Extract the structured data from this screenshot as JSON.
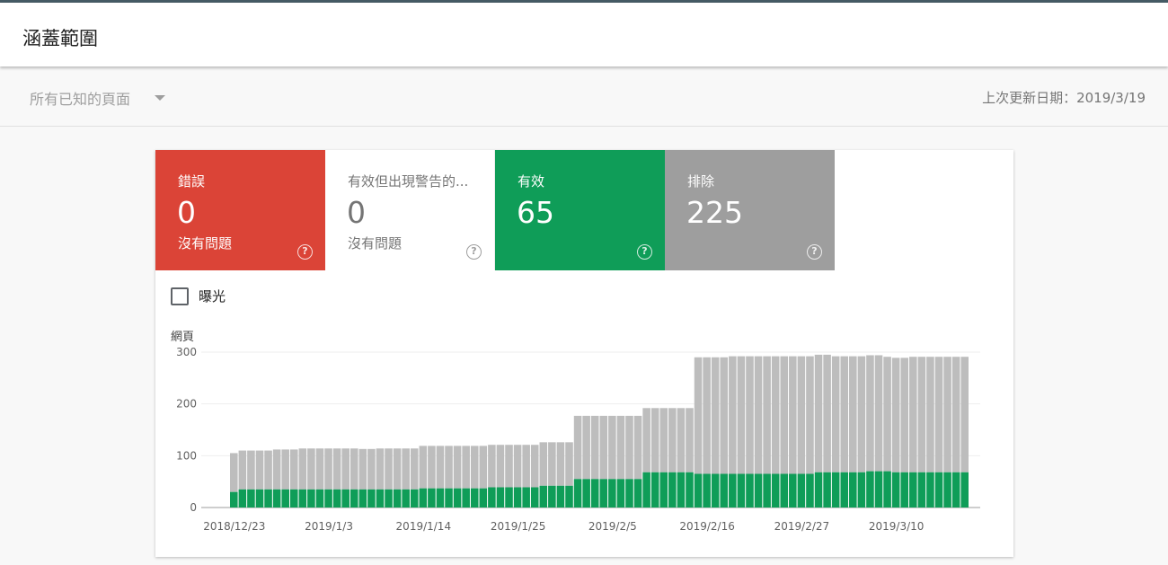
{
  "header": {
    "title": "涵蓋範圍"
  },
  "filter": {
    "selected": "所有已知的頁面",
    "last_updated": "上次更新日期：2019/3/19"
  },
  "tiles": [
    {
      "label": "錯誤",
      "count": "0",
      "sub": "沒有問題",
      "help": "?"
    },
    {
      "label": "有效但出現警告的...",
      "count": "0",
      "sub": "沒有問題",
      "help": "?"
    },
    {
      "label": "有效",
      "count": "65",
      "sub": "",
      "help": "?"
    },
    {
      "label": "排除",
      "count": "225",
      "sub": "",
      "help": "?"
    }
  ],
  "impressions": {
    "label": "曝光",
    "checked": false
  },
  "colors": {
    "valid": "#0f9d58",
    "excluded": "#bdbdbd",
    "error": "#db4437",
    "excluded_tile": "#9e9e9e"
  },
  "chart_data": {
    "type": "bar",
    "ylabel": "網頁",
    "ylim": [
      0,
      300
    ],
    "yticks": [
      0,
      100,
      200,
      300
    ],
    "xtick_labels": [
      "2018/12/23",
      "2019/1/3",
      "2019/1/14",
      "2019/1/25",
      "2019/2/5",
      "2019/2/16",
      "2019/2/27",
      "2019/3/10"
    ],
    "x_start": "2018/12/23",
    "series": [
      {
        "name": "有效",
        "values": [
          30,
          35,
          35,
          35,
          35,
          35,
          35,
          35,
          35,
          35,
          35,
          35,
          35,
          35,
          35,
          35,
          35,
          35,
          35,
          35,
          35,
          35,
          37,
          37,
          37,
          37,
          37,
          37,
          37,
          37,
          39,
          39,
          39,
          39,
          39,
          39,
          42,
          42,
          42,
          42,
          55,
          55,
          55,
          55,
          55,
          55,
          55,
          55,
          68,
          68,
          68,
          68,
          68,
          68,
          65,
          65,
          65,
          65,
          65,
          65,
          65,
          65,
          65,
          65,
          65,
          65,
          65,
          65,
          68,
          68,
          68,
          68,
          68,
          68,
          70,
          70,
          70,
          68,
          68,
          68,
          68,
          68,
          68,
          68,
          68,
          68
        ]
      },
      {
        "name": "排除",
        "values": [
          75,
          75,
          75,
          75,
          75,
          77,
          77,
          77,
          79,
          79,
          79,
          79,
          79,
          79,
          79,
          78,
          78,
          79,
          79,
          79,
          79,
          79,
          82,
          82,
          82,
          82,
          82,
          82,
          82,
          82,
          82,
          82,
          82,
          82,
          82,
          82,
          84,
          84,
          84,
          84,
          122,
          122,
          122,
          122,
          122,
          122,
          122,
          122,
          124,
          124,
          124,
          124,
          124,
          124,
          225,
          225,
          225,
          225,
          227,
          227,
          227,
          227,
          227,
          227,
          227,
          227,
          227,
          227,
          227,
          227,
          224,
          224,
          224,
          224,
          224,
          224,
          221,
          221,
          221,
          223,
          223,
          223,
          223,
          223,
          223,
          223,
          223,
          223
        ]
      }
    ]
  }
}
